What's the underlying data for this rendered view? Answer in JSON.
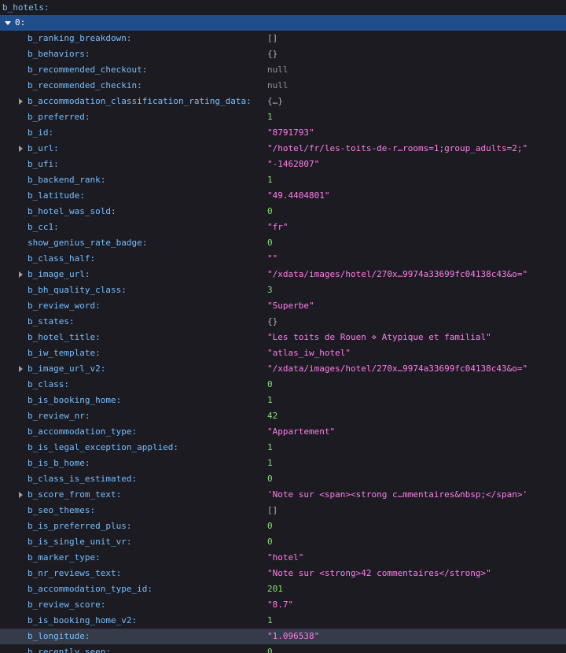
{
  "root_label": "b_hotels:",
  "index_label": "0:",
  "colors": {
    "background": "#1c1b22",
    "key": "#75bfff",
    "string": "#ff7de9",
    "number": "#86de74",
    "null": "#939395",
    "selected_row": "#204e8a",
    "hover_row": "#353b48"
  },
  "rows": [
    {
      "key": "b_ranking_breakdown:",
      "value": "[]",
      "type": "object",
      "expandable": false
    },
    {
      "key": "b_behaviors:",
      "value": "{}",
      "type": "object",
      "expandable": false
    },
    {
      "key": "b_recommended_checkout:",
      "value": "null",
      "type": "null",
      "expandable": false
    },
    {
      "key": "b_recommended_checkin:",
      "value": "null",
      "type": "null",
      "expandable": false
    },
    {
      "key": "b_accommodation_classification_rating_data:",
      "value": "{…}",
      "type": "object",
      "expandable": true
    },
    {
      "key": "b_preferred:",
      "value": "1",
      "type": "number",
      "expandable": false
    },
    {
      "key": "b_id:",
      "value": "\"8791793\"",
      "type": "string",
      "expandable": false
    },
    {
      "key": "b_url:",
      "value": "\"/hotel/fr/les-toits-de-r…rooms=1;group_adults=2;\"",
      "type": "string",
      "expandable": true
    },
    {
      "key": "b_ufi:",
      "value": "\"-1462807\"",
      "type": "string",
      "expandable": false
    },
    {
      "key": "b_backend_rank:",
      "value": "1",
      "type": "number",
      "expandable": false
    },
    {
      "key": "b_latitude:",
      "value": "\"49.4404801\"",
      "type": "string",
      "expandable": false
    },
    {
      "key": "b_hotel_was_sold:",
      "value": "0",
      "type": "number",
      "expandable": false
    },
    {
      "key": "b_cc1:",
      "value": "\"fr\"",
      "type": "string",
      "expandable": false
    },
    {
      "key": "show_genius_rate_badge:",
      "value": "0",
      "type": "number",
      "expandable": false
    },
    {
      "key": "b_class_half:",
      "value": "\"\"",
      "type": "string",
      "expandable": false
    },
    {
      "key": "b_image_url:",
      "value": "\"/xdata/images/hotel/270x…9974a33699fc04138c43&o=\"",
      "type": "string",
      "expandable": true
    },
    {
      "key": "b_bh_quality_class:",
      "value": "3",
      "type": "number",
      "expandable": false
    },
    {
      "key": "b_review_word:",
      "value": "\"Superbe\"",
      "type": "string",
      "expandable": false
    },
    {
      "key": "b_states:",
      "value": "{}",
      "type": "object",
      "expandable": false
    },
    {
      "key": "b_hotel_title:",
      "value": "\"Les toits de Rouen ⋄ Atypique et familial\"",
      "type": "string",
      "expandable": false
    },
    {
      "key": "b_iw_template:",
      "value": "\"atlas_iw_hotel\"",
      "type": "string",
      "expandable": false
    },
    {
      "key": "b_image_url_v2:",
      "value": "\"/xdata/images/hotel/270x…9974a33699fc04138c43&o=\"",
      "type": "string",
      "expandable": true
    },
    {
      "key": "b_class:",
      "value": "0",
      "type": "number",
      "expandable": false
    },
    {
      "key": "b_is_booking_home:",
      "value": "1",
      "type": "number",
      "expandable": false
    },
    {
      "key": "b_review_nr:",
      "value": "42",
      "type": "number",
      "expandable": false
    },
    {
      "key": "b_accommodation_type:",
      "value": "\"Appartement\"",
      "type": "string",
      "expandable": false
    },
    {
      "key": "b_is_legal_exception_applied:",
      "value": "1",
      "type": "number",
      "expandable": false
    },
    {
      "key": "b_is_b_home:",
      "value": "1",
      "type": "number",
      "expandable": false
    },
    {
      "key": "b_class_is_estimated:",
      "value": "0",
      "type": "number",
      "expandable": false
    },
    {
      "key": "b_score_from_text:",
      "value": "'Note sur <span><strong c…mmentaires&nbsp;</span>'",
      "type": "string",
      "expandable": true
    },
    {
      "key": "b_seo_themes:",
      "value": "[]",
      "type": "object",
      "expandable": false
    },
    {
      "key": "b_is_preferred_plus:",
      "value": "0",
      "type": "number",
      "expandable": false
    },
    {
      "key": "b_is_single_unit_vr:",
      "value": "0",
      "type": "number",
      "expandable": false
    },
    {
      "key": "b_marker_type:",
      "value": "\"hotel\"",
      "type": "string",
      "expandable": false
    },
    {
      "key": "b_nr_reviews_text:",
      "value": "\"Note sur <strong>42 commentaires</strong>\"",
      "type": "string",
      "expandable": false
    },
    {
      "key": "b_accommodation_type_id:",
      "value": "201",
      "type": "number",
      "expandable": false
    },
    {
      "key": "b_review_score:",
      "value": "\"8.7\"",
      "type": "string",
      "expandable": false
    },
    {
      "key": "b_is_booking_home_v2:",
      "value": "1",
      "type": "number",
      "expandable": false
    },
    {
      "key": "b_longitude:",
      "value": "\"1.096538\"",
      "type": "string",
      "expandable": false,
      "highlighted": true
    },
    {
      "key": "b_recently_seen:",
      "value": "0",
      "type": "number",
      "expandable": false
    }
  ]
}
